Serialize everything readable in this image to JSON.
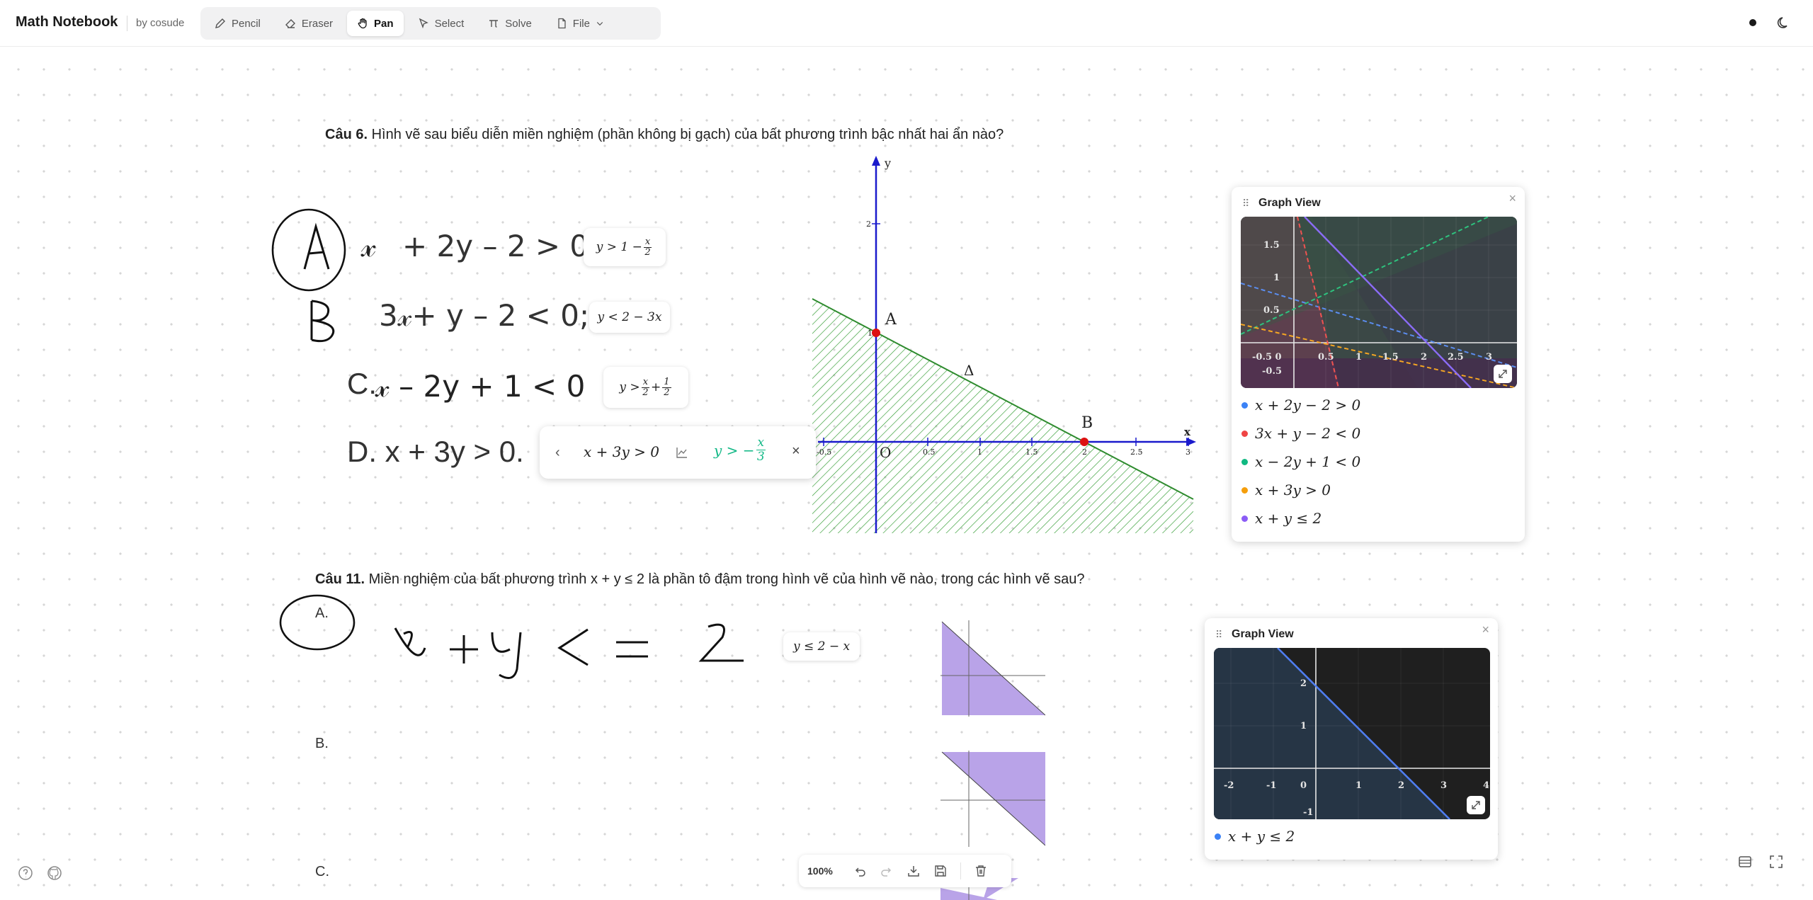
{
  "app": {
    "title": "Math Notebook",
    "author": "by cosude"
  },
  "toolbar": {
    "tools": [
      {
        "label": "Pencil",
        "icon": "pencil-icon"
      },
      {
        "label": "Eraser",
        "icon": "eraser-icon"
      },
      {
        "label": "Pan",
        "icon": "hand-icon",
        "active": true
      },
      {
        "label": "Select",
        "icon": "cursor-icon"
      },
      {
        "label": "Solve",
        "icon": "pi-icon"
      },
      {
        "label": "File",
        "icon": "file-icon"
      }
    ]
  },
  "question6": {
    "number": "Câu 6.",
    "text": "Hình vẽ sau biểu diễn miền nghiệm (phần không bị gạch) của bất phương trình bậc nhất hai ẩn nào?",
    "options": [
      "C.",
      "D. x + 3y > 0."
    ],
    "figure_labels": {
      "y": "y",
      "x": "x",
      "A": "A",
      "B": "B",
      "delta": "Δ",
      "origin": "O",
      "two": "2",
      "one": "1",
      "ticks": [
        "-0.5",
        "0.5",
        "1",
        "1.5",
        "2",
        "2.5",
        "3"
      ]
    },
    "bubbles": {
      "a_prefix": "y > 1 − ",
      "a_num": "x",
      "a_den": "2",
      "b": "y < 2 − 3x",
      "c_prefix": "y > ",
      "c_num1": "x",
      "c_den1": "2",
      "c_plus": " + ",
      "c_num2": "1",
      "c_den2": "2"
    }
  },
  "popover": {
    "expr": "x + 3y > 0",
    "result_prefix": "y > −",
    "result_num": "x",
    "result_den": "3"
  },
  "question11": {
    "number": "Câu 11.",
    "text": "Miền nghiệm của bất phương trình x + y ≤ 2 là phần tô đậm trong hình vẽ của hình vẽ nào, trong các hình vẽ sau?",
    "options": [
      "A.",
      "B.",
      "C."
    ],
    "bubble": "y ≤ 2 − x"
  },
  "graph1": {
    "title": "Graph View",
    "y_ticks": [
      "1.5",
      "1",
      "0.5"
    ],
    "x_ticks": [
      "-0.5 0",
      "0.5",
      "1",
      "1.5",
      "2",
      "2.5",
      "3"
    ],
    "neg_tick": "-0.5",
    "legend": [
      {
        "expr": "x + 2y − 2 > 0",
        "color": "#3b82f6"
      },
      {
        "expr": "3x + y − 2 < 0",
        "color": "#ef4444"
      },
      {
        "expr": "x − 2y + 1 < 0",
        "color": "#10b981"
      },
      {
        "expr": "x + 3y > 0",
        "color": "#f59e0b"
      },
      {
        "expr": "x + y ≤ 2",
        "color": "#8b5cf6"
      }
    ]
  },
  "graph2": {
    "title": "Graph View",
    "y_ticks": [
      "2",
      "1"
    ],
    "x_ticks": [
      "-2",
      "-1",
      "0",
      "1",
      "2",
      "3",
      "4"
    ],
    "neg_tick": "-1",
    "legend": [
      {
        "expr": "x + y ≤ 2",
        "color": "#3b82f6"
      }
    ]
  },
  "bottom_bar": {
    "zoom": "100%"
  }
}
